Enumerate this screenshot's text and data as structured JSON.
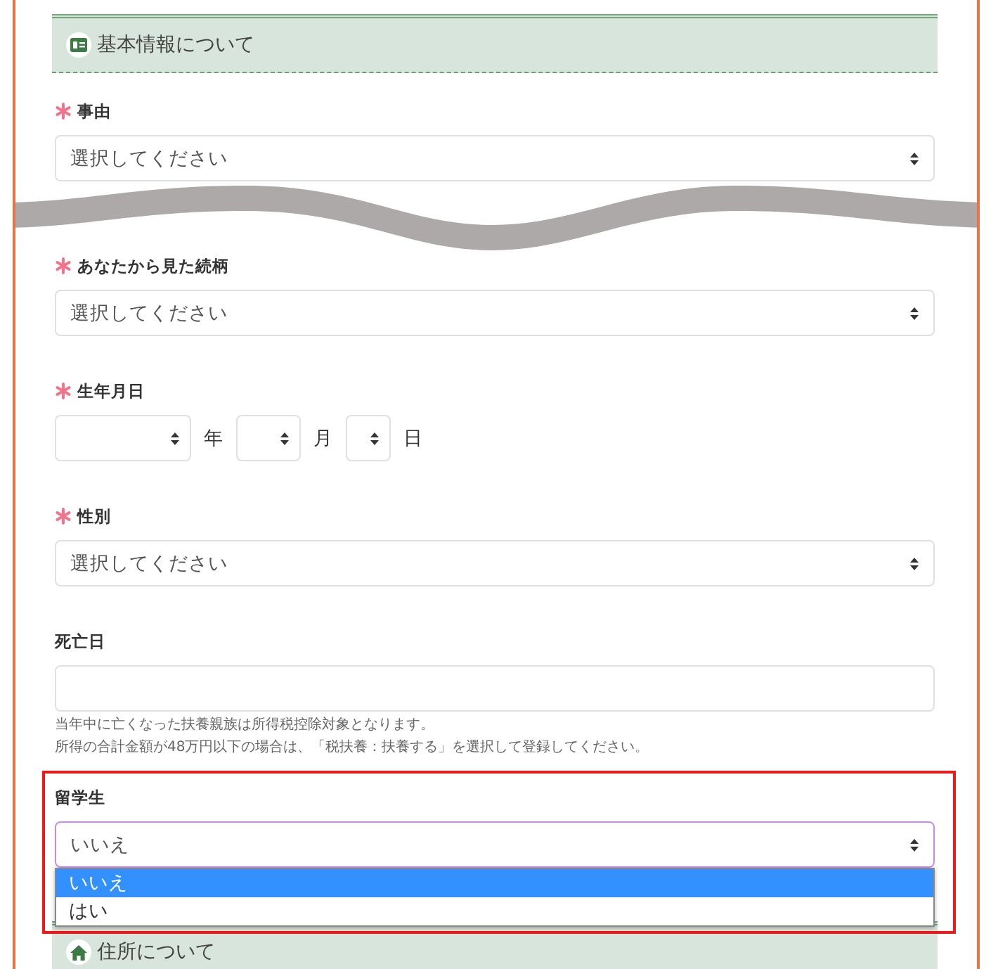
{
  "section_header": {
    "title": "基本情報について"
  },
  "fields": [
    {
      "kind": "select",
      "label": "事由",
      "required": true,
      "value": "選択してください"
    },
    {
      "kind": "select",
      "label": "あなたから見た続柄",
      "required": true,
      "value": "選択してください"
    },
    {
      "kind": "date",
      "label": "生年月日",
      "required": true,
      "parts": [
        {
          "unit": "年"
        },
        {
          "unit": "月"
        },
        {
          "unit": "日"
        }
      ]
    },
    {
      "kind": "select",
      "label": "性別",
      "required": true,
      "value": "選択してください"
    },
    {
      "kind": "text",
      "label": "死亡日",
      "required": false,
      "hints": [
        "当年中に亡くなった扶養親族は所得税控除対象となります。",
        "所得の合計金額が48万円以下の場合は、「税扶養：扶養する」を選択して登録してください。"
      ]
    },
    {
      "kind": "select",
      "label": "留学生",
      "required": false,
      "value": "いいえ",
      "highlighted": true,
      "open": true,
      "options": [
        {
          "label": "いいえ",
          "selected": true
        },
        {
          "label": "はい",
          "selected": false
        }
      ]
    }
  ],
  "next_section_header": {
    "title": "住所について"
  }
}
